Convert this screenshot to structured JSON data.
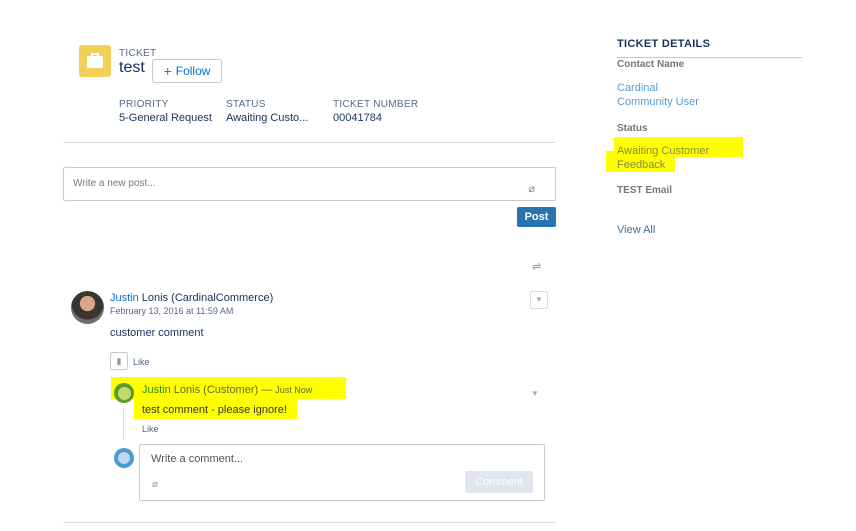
{
  "header": {
    "object_type": "TICKET",
    "title": "test",
    "follow_label": "Follow"
  },
  "fields": [
    {
      "label": "PRIORITY",
      "value": "5-General Request"
    },
    {
      "label": "STATUS",
      "value": "Awaiting Custo..."
    },
    {
      "label": "TICKET NUMBER",
      "value": "00041784"
    }
  ],
  "publisher": {
    "placeholder": "Write a new post...",
    "post_label": "Post"
  },
  "feed": {
    "post": {
      "author_first": "Justin",
      "author_rest": " Lonis (CardinalCommerce)",
      "timestamp": "February 13, 2016 at 11:59 AM",
      "body": "customer comment",
      "like_label": "Like"
    },
    "comment": {
      "author_first": "Justin",
      "author_rest": " Lonis (Customer)",
      "dash": " — ",
      "time": "Just Now",
      "body": "test comment - please ignore!",
      "like_label": "Like"
    },
    "reply": {
      "placeholder": "Write a comment...",
      "comment_label": "Comment"
    }
  },
  "details": {
    "title": "TICKET DETAILS",
    "contact_label": "Contact Name",
    "contact_value_1": "Cardinal",
    "contact_value_2": "Community User",
    "status_label": "Status",
    "status_value_1": "Awaiting Customer",
    "status_value_2": "Feedback",
    "email_label": "TEST Email",
    "view_all": "View All"
  },
  "colors": {
    "brand": "#f2cf5b",
    "post_button": "#2a73b0",
    "highlight": "#ffff00"
  }
}
